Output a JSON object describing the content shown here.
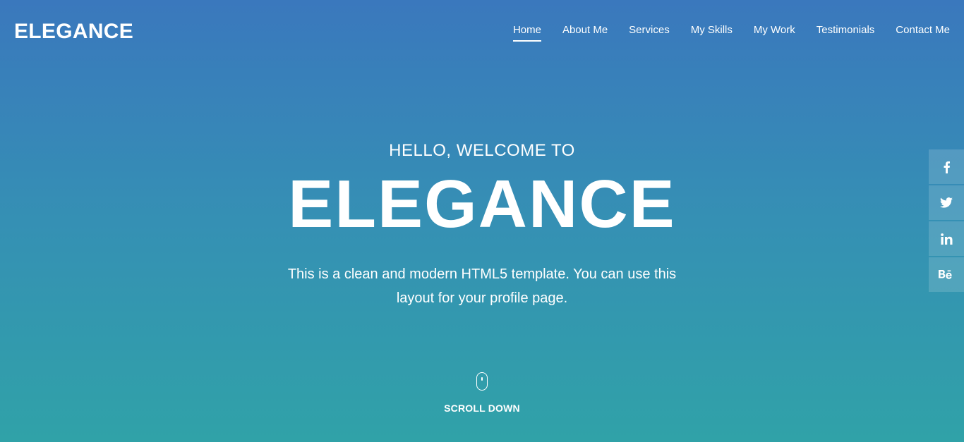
{
  "brand": {
    "name": "ELEGANCE"
  },
  "nav": {
    "items": [
      {
        "label": "Home",
        "active": true
      },
      {
        "label": "About Me"
      },
      {
        "label": "Services"
      },
      {
        "label": "My Skills"
      },
      {
        "label": "My Work"
      },
      {
        "label": "Testimonials"
      },
      {
        "label": "Contact Me"
      }
    ]
  },
  "hero": {
    "greeting": "HELLO, WELCOME TO",
    "title": "ELEGANCE",
    "description": "This is a clean and modern HTML5 template. You can use this layout for your profile page."
  },
  "scroll": {
    "label": "SCROLL DOWN",
    "icon": "mouse-icon"
  },
  "social": [
    {
      "icon": "facebook-icon",
      "glyph": "f"
    },
    {
      "icon": "twitter-icon",
      "glyph": "🐦"
    },
    {
      "icon": "linkedin-icon",
      "glyph": "in"
    },
    {
      "icon": "behance-icon",
      "glyph": "Bē"
    }
  ],
  "colors": {
    "gradient_top": "#3a78bd",
    "gradient_bottom": "#30a2a8",
    "text": "#ffffff"
  }
}
